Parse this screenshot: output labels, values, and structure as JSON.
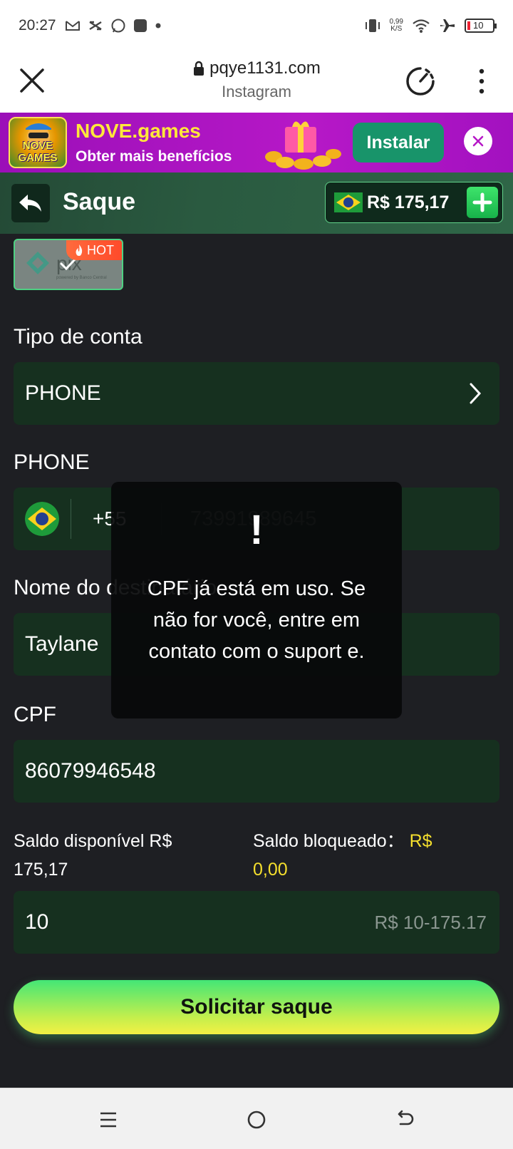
{
  "status_bar": {
    "time": "20:27",
    "net_speed_top": "0,99",
    "net_speed_unit": "K/S",
    "battery": "10"
  },
  "browser": {
    "url": "pqye1131.com",
    "subtitle": "Instagram"
  },
  "ad": {
    "logo_text": "NOVE GAMES",
    "title": "NOVE.games",
    "subtitle": "Obter mais benefícios",
    "install_label": "Instalar"
  },
  "header": {
    "title": "Saque",
    "balance": "R$ 175,17"
  },
  "pix": {
    "hot_label": "HOT"
  },
  "form": {
    "account_type_label": "Tipo de conta",
    "account_type_value": "PHONE",
    "phone_label": "PHONE",
    "phone_code": "+55",
    "phone_number": "73991989645",
    "name_label": "Nome do destinatário",
    "name_value": "Taylane",
    "cpf_label": "CPF",
    "cpf_value": "86079946548",
    "available_label": "Saldo disponível R$",
    "available_value": "175,17",
    "blocked_label": "Saldo bloqueado：",
    "blocked_currency": "R$",
    "blocked_value": "0,00",
    "amount_value": "10",
    "amount_hint": "R$ 10-175.17",
    "submit_label": "Solicitar saque"
  },
  "toast": {
    "icon": "!",
    "message": "CPF já está em uso. Se não for você, entre em contato com o suport e."
  },
  "colors": {
    "accent_green": "#3ee46b",
    "field_bg": "#16301f",
    "yellow": "#f5df2d",
    "ad_purple": "#b618c7"
  }
}
